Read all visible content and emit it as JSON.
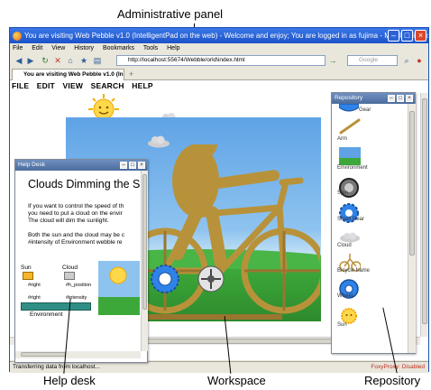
{
  "callouts": {
    "admin_panel": "Administrative panel",
    "help_desk": "Help desk",
    "workspace": "Workspace",
    "repository": "Repository"
  },
  "browser": {
    "title": "You are visiting Web Pebble v1.0 (IntelligentPad on the web) - Welcome and enjoy; You are logged in as fujima - Mozilla Firefox IBMT ...",
    "menu": [
      "File",
      "Edit",
      "View",
      "History",
      "Bookmarks",
      "Tools",
      "Help"
    ],
    "url": "http://localhost:55674/Webble/orld\\index.html",
    "search_placeholder": "Google",
    "tab_label": "You are visiting Web Pebble v1.0 (In...",
    "status": "Transferring data from localhost...",
    "status_right": "FoxyProxy: Disabled"
  },
  "app_menu": [
    "FILE",
    "EDIT",
    "VIEW",
    "SEARCH",
    "HELP"
  ],
  "help_desk": {
    "title": "Help Desk",
    "heading": "Clouds Dimming the S",
    "para1": [
      "If you want to control the speed of th",
      "you need to put a cloud on the envir",
      "The cloud will dim the sunlight."
    ],
    "para2": [
      "Both the sun and the cloud may be c",
      "#intensity of Environment webble re"
    ],
    "diagram": {
      "sun": "Sun",
      "cloud": "Cloud",
      "right1": "#right",
      "pos": "#h_position",
      "right2": "#right",
      "intensity": "#intensity",
      "env": "Environment"
    }
  },
  "repository": {
    "title": "Repository",
    "items": [
      "Gear",
      "Arm",
      "Environment",
      "Spin",
      "Small Gear",
      "Cloud",
      "Bicycle frame",
      "Wheel",
      "Sun"
    ]
  },
  "colors": {
    "titlebar": "#1c52c9",
    "panel_title": "#4b6b9c",
    "bike": "#b8923a",
    "sky": "#8ec3ef",
    "grass": "#3ca83a"
  }
}
